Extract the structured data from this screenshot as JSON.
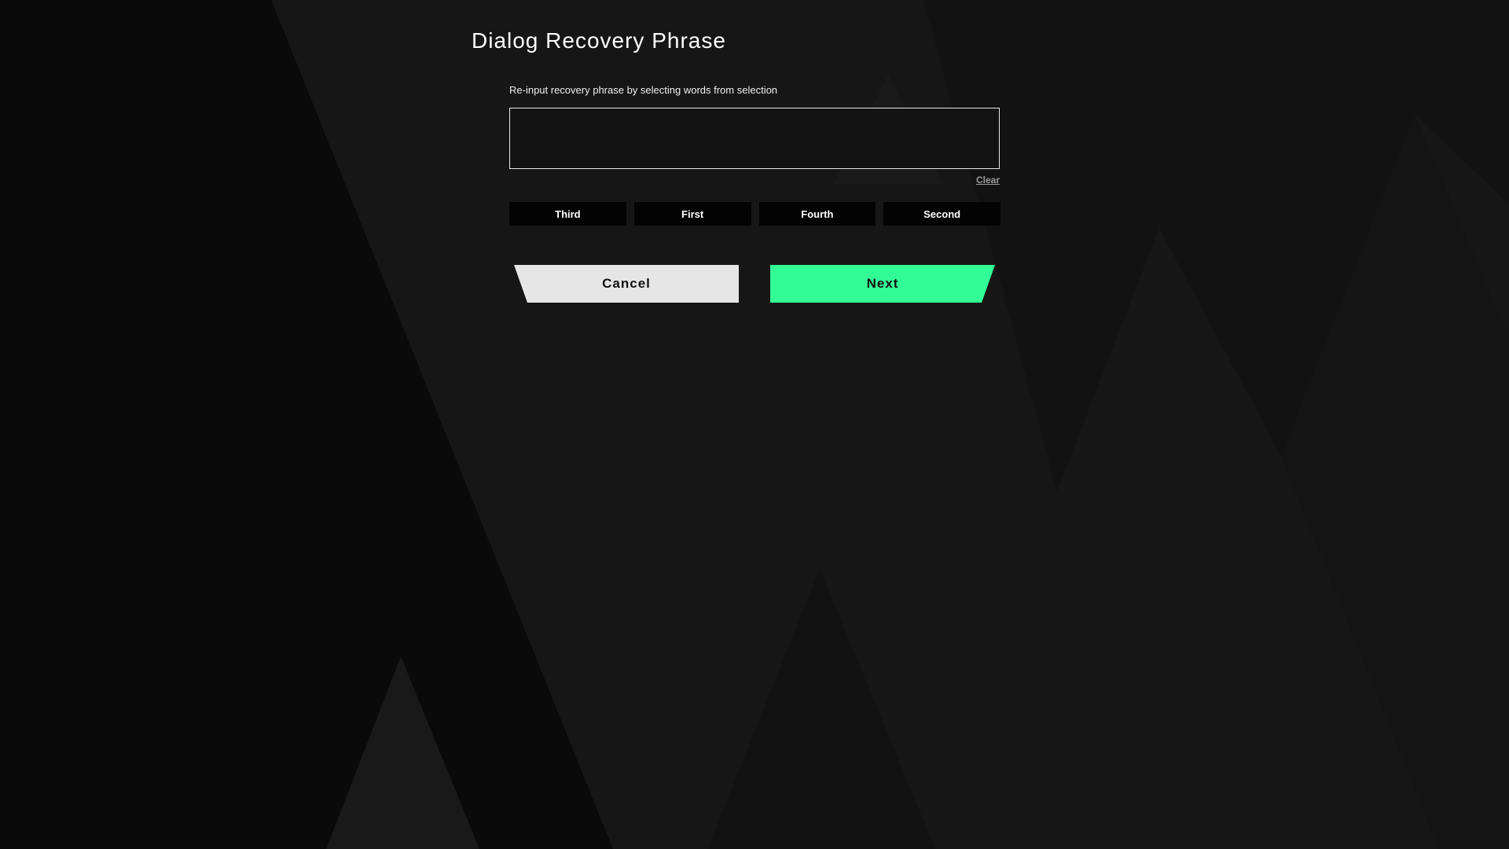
{
  "dialog": {
    "title": "Dialog Recovery Phrase",
    "instruction": "Re-input recovery phrase by selecting words from selection",
    "phrase_value": "",
    "clear_label": "Clear",
    "word_options": [
      "Third",
      "First",
      "Fourth",
      "Second"
    ],
    "cancel_label": "Cancel",
    "next_label": "Next"
  },
  "colors": {
    "background": "#161616",
    "next_button": "#33fc96",
    "cancel_button": "#e6e6e6",
    "word_chip": "#030303"
  }
}
